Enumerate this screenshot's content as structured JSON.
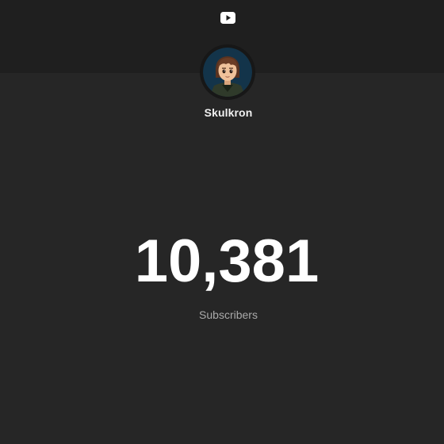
{
  "brand": {
    "icon": "youtube-icon",
    "color": "#ffffff"
  },
  "channel": {
    "name": "Skulkron",
    "avatar_icon": "avatar-icon"
  },
  "stats": {
    "subscriber_count": "10,381",
    "subscriber_label": "Subscribers"
  },
  "colors": {
    "background": "#262626",
    "header_band": "#1f1f1f",
    "count_text": "#ffffff",
    "label_text": "#aaaaaa"
  }
}
